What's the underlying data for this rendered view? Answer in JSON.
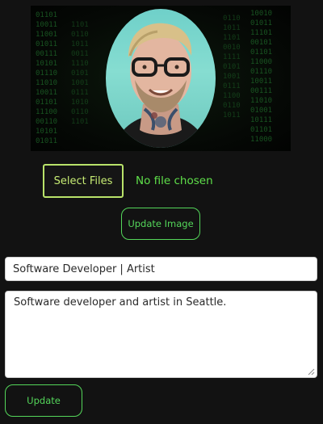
{
  "profile": {
    "avatar_icon": "profile-photo",
    "file_picker": {
      "button_label": "Select Files",
      "status": "No file chosen"
    },
    "update_image_label": "Update Image",
    "title_value": "Software Developer | Artist",
    "bio_value": "Software developer and artist in Seattle.",
    "update_label": "Update"
  },
  "colors": {
    "background": "#121212",
    "accent_green": "#54d65a",
    "select_border": "#b9e36a"
  }
}
